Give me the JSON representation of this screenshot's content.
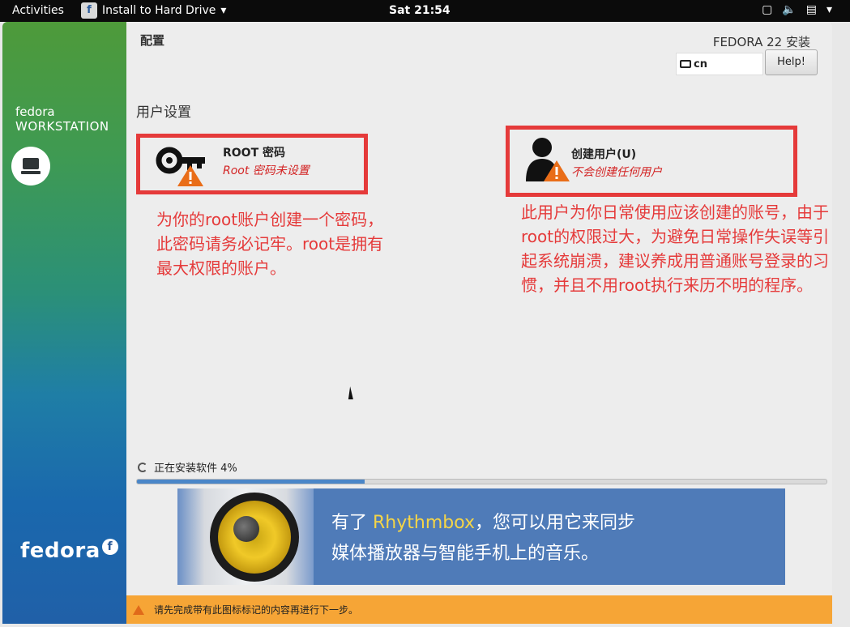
{
  "topbar": {
    "activities": "Activities",
    "app_name": "Install to Hard Drive",
    "app_icon_letter": "f",
    "clock": "Sat 21:54",
    "tray_icons": [
      "window-icon",
      "volume-icon",
      "battery-icon",
      "chevron-down-icon"
    ]
  },
  "sidebar": {
    "brand_top_line1": "fedora",
    "brand_top_line2": "WORKSTATION",
    "brand_bottom": "fedora",
    "brand_bottom_icon": "f"
  },
  "header": {
    "title": "配置",
    "product": "FEDORA 22 安装",
    "keyboard_layout": "cn",
    "help_label": "Help!"
  },
  "section": {
    "title": "用户设置"
  },
  "hubs": {
    "root": {
      "title": "ROOT 密码",
      "status": "Root 密码未设置",
      "icon": "key-warning-icon"
    },
    "user": {
      "title": "创建用户(U)",
      "status": "不会创建任何用户",
      "icon": "user-warning-icon"
    }
  },
  "annotations": {
    "root_note": "为你的root账户创建一个密码，此密码请务必记牢。root是拥有最大权限的账户。",
    "user_note": "此用户为你日常使用应该创建的账号，由于root的权限过大，为避免日常操作失误等引起系统崩溃，建议养成用普通账号登录的习惯，并且不用root执行来历不明的程序。"
  },
  "progress": {
    "label": "正在安装软件 4%",
    "fraction": 0.33
  },
  "banner": {
    "line1_prefix": "有了 ",
    "line1_highlight": "Rhythmbox",
    "line1_suffix": "，您可以用它来同步",
    "line2": "媒体播放器与智能手机上的音乐。"
  },
  "warning": {
    "text": "请先完成带有此图标标记的内容再进行下一步。"
  },
  "colors": {
    "annotation_red": "#e53a3a",
    "status_red": "#d32323",
    "warning_bar": "#f6a536",
    "progress_blue": "#4a86c8",
    "banner_blue": "#4f7bb8",
    "banner_highlight": "#f5d547"
  }
}
